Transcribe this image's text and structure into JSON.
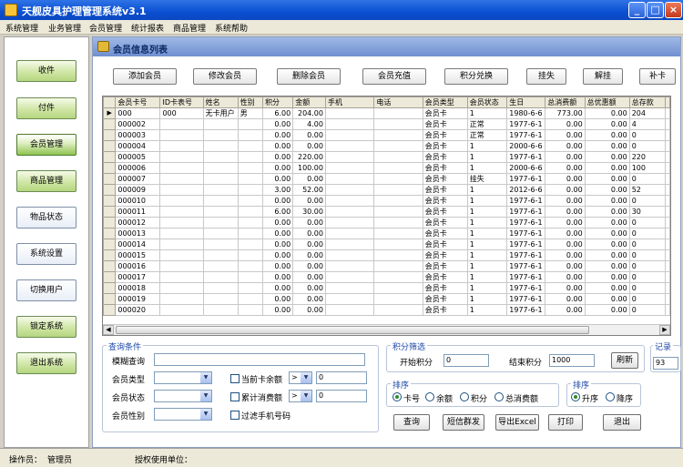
{
  "window": {
    "title": "天舰皮具护理管理系统v3.1"
  },
  "menu": [
    "系统管理",
    "业务管理",
    "会员管理",
    "统计报表",
    "商品管理",
    "系统帮助"
  ],
  "nav": [
    {
      "label": "收件"
    },
    {
      "label": "付件"
    },
    {
      "label": "会员管理"
    },
    {
      "label": "商品管理"
    },
    {
      "label": "物品状态"
    },
    {
      "label": "系统设置"
    },
    {
      "label": "切换用户"
    },
    {
      "label": "锁定系统"
    },
    {
      "label": "退出系统"
    }
  ],
  "panel": {
    "title": "会员信息列表"
  },
  "toolbar": [
    "添加会员",
    "修改会员",
    "删除会员",
    "会员充值",
    "积分兑换",
    "挂失",
    "解挂",
    "补卡"
  ],
  "table": {
    "columns": [
      "会员卡号",
      "ID卡表号",
      "姓名",
      "性别",
      "积分",
      "金额",
      "手机",
      "电话",
      "会员类型",
      "会员状态",
      "生日",
      "总消费额",
      "总优惠额",
      "总存款"
    ],
    "rows": [
      [
        "000",
        "000",
        "无卡用户",
        "男",
        "6.00",
        "204.00",
        "",
        "",
        "会员卡",
        "1",
        "1980-6-6",
        "773.00",
        "0.00",
        "204"
      ],
      [
        "000002",
        "",
        "",
        "",
        "0.00",
        "4.00",
        "",
        "",
        "会员卡",
        "正常",
        "1977-6-1",
        "0.00",
        "0.00",
        "4"
      ],
      [
        "000003",
        "",
        "",
        "",
        "0.00",
        "0.00",
        "",
        "",
        "会员卡",
        "正常",
        "1977-6-1",
        "0.00",
        "0.00",
        "0"
      ],
      [
        "000004",
        "",
        "",
        "",
        "0.00",
        "0.00",
        "",
        "",
        "会员卡",
        "1",
        "2000-6-6",
        "0.00",
        "0.00",
        "0"
      ],
      [
        "000005",
        "",
        "",
        "",
        "0.00",
        "220.00",
        "",
        "",
        "会员卡",
        "1",
        "1977-6-1",
        "0.00",
        "0.00",
        "220"
      ],
      [
        "000006",
        "",
        "",
        "",
        "0.00",
        "100.00",
        "",
        "",
        "会员卡",
        "1",
        "2000-6-6",
        "0.00",
        "0.00",
        "100"
      ],
      [
        "000007",
        "",
        "",
        "",
        "0.00",
        "0.00",
        "",
        "",
        "会员卡",
        "挂失",
        "1977-6-1",
        "0.00",
        "0.00",
        "0"
      ],
      [
        "000009",
        "",
        "",
        "",
        "3.00",
        "52.00",
        "",
        "",
        "会员卡",
        "1",
        "2012-6-6",
        "0.00",
        "0.00",
        "52"
      ],
      [
        "000010",
        "",
        "",
        "",
        "0.00",
        "0.00",
        "",
        "",
        "会员卡",
        "1",
        "1977-6-1",
        "0.00",
        "0.00",
        "0"
      ],
      [
        "000011",
        "",
        "",
        "",
        "6.00",
        "30.00",
        "",
        "",
        "会员卡",
        "1",
        "1977-6-1",
        "0.00",
        "0.00",
        "30"
      ],
      [
        "000012",
        "",
        "",
        "",
        "0.00",
        "0.00",
        "",
        "",
        "会员卡",
        "1",
        "1977-6-1",
        "0.00",
        "0.00",
        "0"
      ],
      [
        "000013",
        "",
        "",
        "",
        "0.00",
        "0.00",
        "",
        "",
        "会员卡",
        "1",
        "1977-6-1",
        "0.00",
        "0.00",
        "0"
      ],
      [
        "000014",
        "",
        "",
        "",
        "0.00",
        "0.00",
        "",
        "",
        "会员卡",
        "1",
        "1977-6-1",
        "0.00",
        "0.00",
        "0"
      ],
      [
        "000015",
        "",
        "",
        "",
        "0.00",
        "0.00",
        "",
        "",
        "会员卡",
        "1",
        "1977-6-1",
        "0.00",
        "0.00",
        "0"
      ],
      [
        "000016",
        "",
        "",
        "",
        "0.00",
        "0.00",
        "",
        "",
        "会员卡",
        "1",
        "1977-6-1",
        "0.00",
        "0.00",
        "0"
      ],
      [
        "000017",
        "",
        "",
        "",
        "0.00",
        "0.00",
        "",
        "",
        "会员卡",
        "1",
        "1977-6-1",
        "0.00",
        "0.00",
        "0"
      ],
      [
        "000018",
        "",
        "",
        "",
        "0.00",
        "0.00",
        "",
        "",
        "会员卡",
        "1",
        "1977-6-1",
        "0.00",
        "0.00",
        "0"
      ],
      [
        "000019",
        "",
        "",
        "",
        "0.00",
        "0.00",
        "",
        "",
        "会员卡",
        "1",
        "1977-6-1",
        "0.00",
        "0.00",
        "0"
      ],
      [
        "000020",
        "",
        "",
        "",
        "0.00",
        "0.00",
        "",
        "",
        "会员卡",
        "1",
        "1977-6-1",
        "0.00",
        "0.00",
        "0"
      ]
    ]
  },
  "query": {
    "group_label": "查询条件",
    "fuzzy_label": "模糊查询",
    "type_label": "会员类型",
    "status_label": "会员状态",
    "gender_label": "会员性别",
    "balance_label": "当前卡余额",
    "consume_label": "累计消费额",
    "filter_phone_label": "过滤手机号码",
    "op1": ">",
    "val1": "0",
    "op2": ">",
    "val2": "0"
  },
  "points": {
    "group_label": "积分筛选",
    "start_label": "开始积分",
    "start_val": "0",
    "end_label": "结束积分",
    "end_val": "1000",
    "refresh": "刷新"
  },
  "sort": {
    "group_label": "排序",
    "options": [
      "卡号",
      "余额",
      "积分",
      "总消费额"
    ],
    "dir_label": "排序",
    "asc": "升序",
    "desc": "降序"
  },
  "record": {
    "label": "记录",
    "value": "93"
  },
  "actions": {
    "query": "查询",
    "sms": "短信群发",
    "export": "导出Excel",
    "print": "打印",
    "exit": "退出"
  },
  "status": {
    "operator_label": "操作员：",
    "operator": "管理员",
    "license_label": "授权使用单位："
  }
}
